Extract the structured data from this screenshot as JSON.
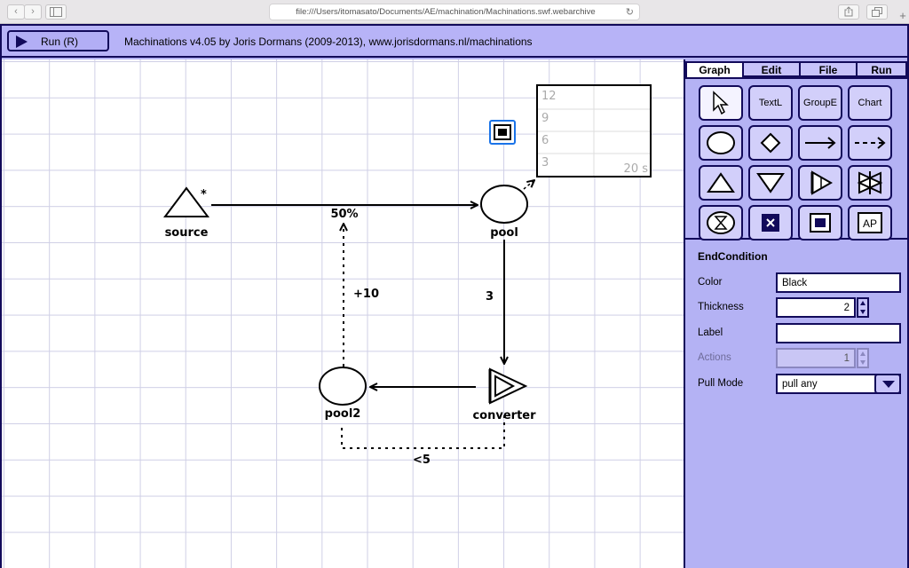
{
  "browser": {
    "url": "file:///Users/itomasato/Documents/AE/machination/Machinations.swf.webarchive",
    "back_icon": "chevron-left-icon",
    "forward_icon": "chevron-right-icon"
  },
  "toolbar": {
    "run_label": "Run (R)",
    "title": "Machinations v4.05 by Joris Dormans (2009-2013), www.jorisdormans.nl/machinations"
  },
  "tabs": [
    {
      "label": "Graph",
      "active": true
    },
    {
      "label": "Edit",
      "active": false
    },
    {
      "label": "File",
      "active": false
    },
    {
      "label": "Run",
      "active": false
    }
  ],
  "tools": [
    {
      "name": "select",
      "label": ""
    },
    {
      "name": "text-label",
      "label": "TextL"
    },
    {
      "name": "group-box",
      "label": "GroupE"
    },
    {
      "name": "chart",
      "label": "Chart"
    },
    {
      "name": "pool",
      "label": ""
    },
    {
      "name": "gate",
      "label": ""
    },
    {
      "name": "resource-connection",
      "label": ""
    },
    {
      "name": "state-connection",
      "label": ""
    },
    {
      "name": "source",
      "label": ""
    },
    {
      "name": "drain",
      "label": ""
    },
    {
      "name": "converter",
      "label": ""
    },
    {
      "name": "trader",
      "label": ""
    },
    {
      "name": "delay",
      "label": ""
    },
    {
      "name": "end-condition",
      "label": ""
    },
    {
      "name": "register",
      "label": ""
    },
    {
      "name": "artificial-player",
      "label": "AP"
    }
  ],
  "properties": {
    "title": "EndCondition",
    "color_label": "Color",
    "color_value": "Black",
    "thickness_label": "Thickness",
    "thickness_value": "2",
    "label_label": "Label",
    "label_value": "",
    "actions_label": "Actions",
    "actions_value": "1",
    "pull_mode_label": "Pull Mode",
    "pull_mode_value": "pull any"
  },
  "diagram": {
    "source_label": "source",
    "source_marker": "*",
    "pool_label": "pool",
    "pool2_label": "pool2",
    "converter_label": "converter",
    "edge_source_pool_label": "50%",
    "edge_pool2_label": "+10",
    "edge_pool_converter_label": "3",
    "edge_bottom_label": "<5"
  },
  "chart_widget": {
    "y_ticks": [
      "12",
      "9",
      "6",
      "3"
    ],
    "time_label": "20 s"
  }
}
